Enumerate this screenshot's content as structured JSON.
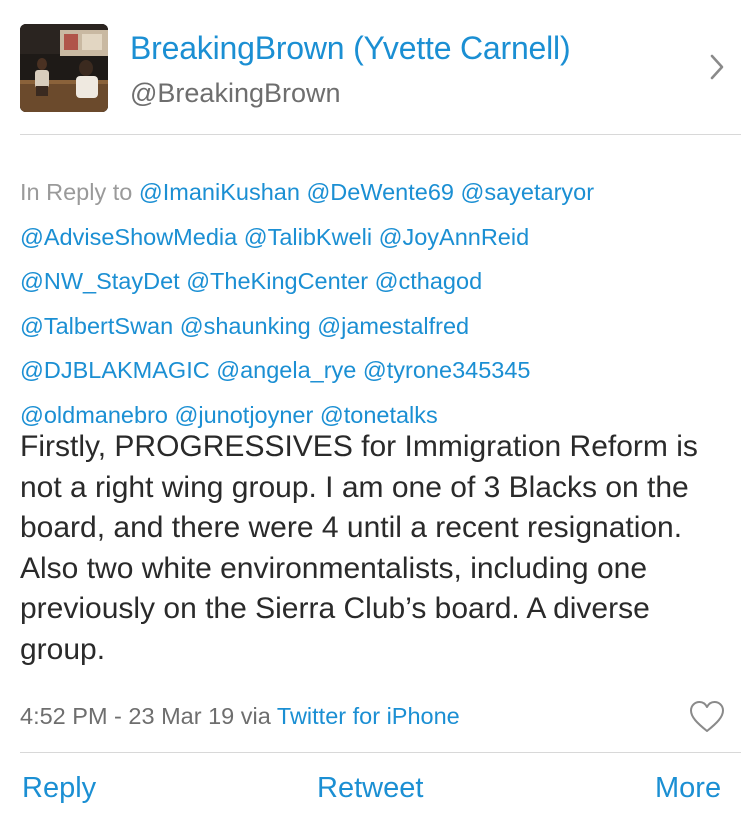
{
  "profile": {
    "name": "BreakingBrown (Yvette Carnell)",
    "handle": "@BreakingBrown",
    "avatar_icon": "profile-photo",
    "chevron_icon": "chevron-right-icon"
  },
  "reply": {
    "label": "In Reply to",
    "mentions": [
      "@ImaniKushan",
      "@DeWente69",
      "@sayetaryor",
      "@AdviseShowMedia",
      "@TalibKweli",
      "@JoyAnnReid",
      "@NW_StayDet",
      "@TheKingCenter",
      "@cthagod",
      "@TalbertSwan",
      "@shaunking",
      "@jamestalfred",
      "@DJBLAKMAGIC",
      "@angela_rye",
      "@tyrone345345",
      "@oldmanebro",
      "@junotjoyner",
      "@tonetalks"
    ]
  },
  "tweet": {
    "text": "Firstly, PROGRESSIVES for Immigration Reform is not a right wing group. I am one of 3 Blacks on the board, and there were 4 until a recent resignation. Also two white environmentalists, including one previously on the Sierra Club’s board. A diverse group.",
    "timestamp": "4:52 PM - 23 Mar 19 via",
    "source": "Twitter for iPhone",
    "like_icon": "heart-icon"
  },
  "actions": {
    "reply": "Reply",
    "retweet": "Retweet",
    "more": "More"
  },
  "colors": {
    "link": "#1b8fd3",
    "text": "#2a2a2a",
    "muted": "#6e6e6e",
    "divider": "#d8d8d8"
  }
}
